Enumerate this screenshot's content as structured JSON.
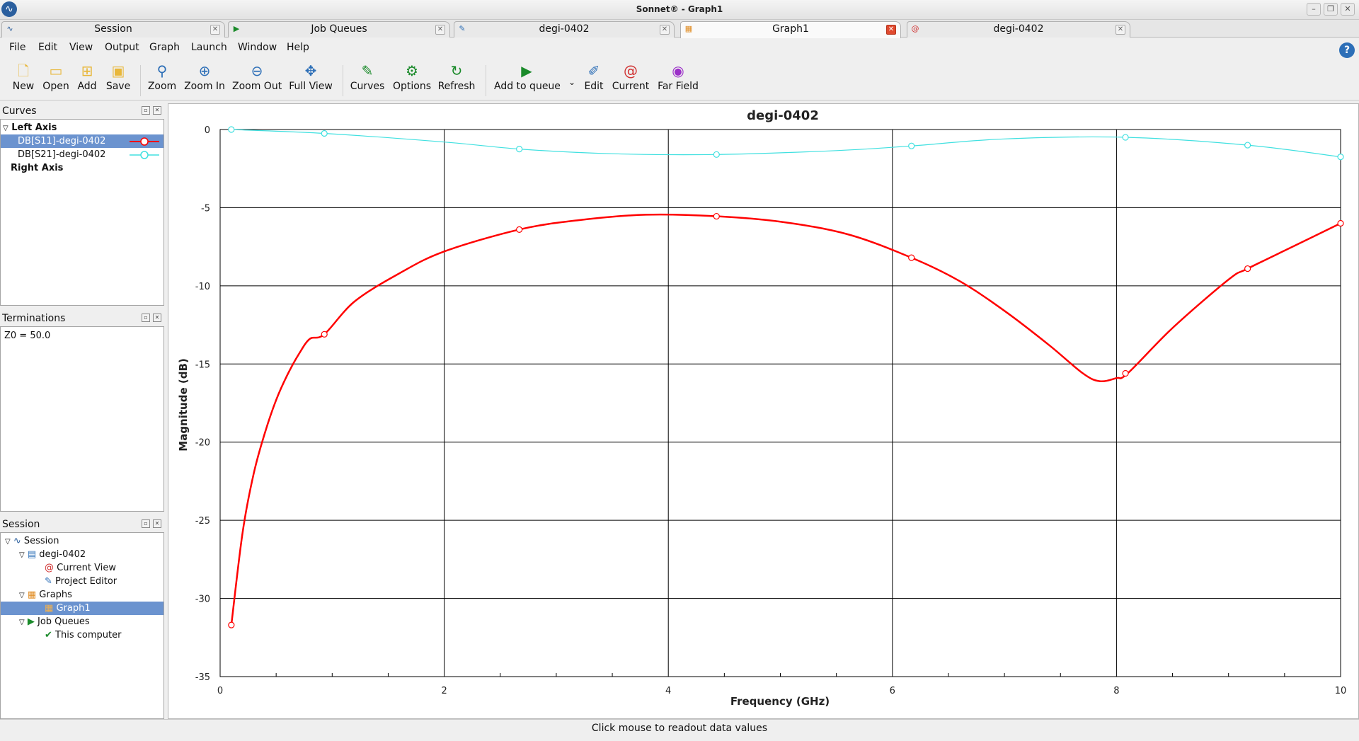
{
  "window": {
    "title": "Sonnet® - Graph1"
  },
  "tabs": [
    {
      "label": "Session",
      "icon": "session-wave-icon"
    },
    {
      "label": "Job Queues",
      "icon": "em-play-icon"
    },
    {
      "label": "degi-0402",
      "icon": "project-editor-icon"
    },
    {
      "label": "Graph1",
      "icon": "graph-icon"
    },
    {
      "label": "degi-0402",
      "icon": "current-spiral-icon"
    }
  ],
  "menu": [
    "File",
    "Edit",
    "View",
    "Output",
    "Graph",
    "Launch",
    "Window",
    "Help"
  ],
  "toolbar": {
    "new": "New",
    "open": "Open",
    "add": "Add",
    "save": "Save",
    "zoom": "Zoom",
    "zoom_in": "Zoom In",
    "zoom_out": "Zoom Out",
    "full_view": "Full View",
    "curves": "Curves",
    "options": "Options",
    "refresh": "Refresh",
    "add_to_queue": "Add to queue",
    "edit": "Edit",
    "current": "Current",
    "far_field": "Far Field"
  },
  "curves_panel": {
    "title": "Curves",
    "left_axis": "Left Axis",
    "items": [
      "DB[S11]-degi-0402",
      "DB[S21]-degi-0402"
    ],
    "right_axis": "Right Axis"
  },
  "terminations_panel": {
    "title": "Terminations",
    "text": "Z0 = 50.0"
  },
  "session_panel": {
    "title": "Session",
    "tree": {
      "root": "Session",
      "project": "degi-0402",
      "current_view": "Current View",
      "project_editor": "Project Editor",
      "graphs": "Graphs",
      "graph1": "Graph1",
      "job_queues": "Job Queues",
      "this_computer": "This computer"
    }
  },
  "status": {
    "text": "Click mouse to readout data values"
  },
  "colors": {
    "s11": "#ff0000",
    "s21": "#40e0e0",
    "selection": "#6b93cf"
  },
  "chart_data": {
    "type": "line",
    "title": "degi-0402",
    "xlabel": "Frequency (GHz)",
    "ylabel": "Magnitude (dB)",
    "xlim": [
      0,
      10
    ],
    "ylim": [
      -35,
      0
    ],
    "xticks": [
      0,
      2,
      4,
      6,
      8,
      10
    ],
    "yticks": [
      0,
      -5,
      -10,
      -15,
      -20,
      -25,
      -30,
      -35
    ],
    "grid": true,
    "series": [
      {
        "name": "DB[S11]-degi-0402",
        "color": "#ff0000",
        "x": [
          0.1,
          0.2,
          0.3,
          0.4,
          0.5,
          0.6,
          0.7,
          0.8,
          0.93,
          1.2,
          1.6,
          2.0,
          2.67,
          3.2,
          3.8,
          4.43,
          5.0,
          5.6,
          6.17,
          6.6,
          7.0,
          7.4,
          7.7,
          7.85,
          8.0,
          8.1,
          8.5,
          9.0,
          9.17,
          9.6,
          10.0
        ],
        "y": [
          -31.7,
          -25.8,
          -22.0,
          -19.4,
          -17.3,
          -15.7,
          -14.4,
          -13.4,
          -13.1,
          -11.0,
          -9.2,
          -7.8,
          -6.4,
          -5.8,
          -5.45,
          -5.55,
          -5.9,
          -6.7,
          -8.2,
          -9.7,
          -11.6,
          -13.8,
          -15.6,
          -16.1,
          -15.9,
          -15.6,
          -12.7,
          -9.6,
          -8.9,
          -7.4,
          -6.0
        ]
      },
      {
        "name": "DB[S21]-degi-0402",
        "color": "#40e0e0",
        "x": [
          0.1,
          0.93,
          2.0,
          2.67,
          3.5,
          4.43,
          5.5,
          6.17,
          7.0,
          8.08,
          9.17,
          10.0
        ],
        "y": [
          0.0,
          -0.25,
          -0.8,
          -1.25,
          -1.55,
          -1.6,
          -1.35,
          -1.05,
          -0.6,
          -0.5,
          -1.0,
          -1.75
        ]
      }
    ],
    "markers": {
      "DB[S11]-degi-0402": [
        [
          0.1,
          -31.7
        ],
        [
          0.93,
          -13.1
        ],
        [
          2.67,
          -6.4
        ],
        [
          4.43,
          -5.55
        ],
        [
          6.17,
          -8.2
        ],
        [
          8.08,
          -15.6
        ],
        [
          9.17,
          -8.9
        ],
        [
          10.0,
          -6.0
        ]
      ],
      "DB[S21]-degi-0402": [
        [
          0.1,
          0.0
        ],
        [
          0.93,
          -0.25
        ],
        [
          2.67,
          -1.25
        ],
        [
          4.43,
          -1.6
        ],
        [
          6.17,
          -1.05
        ],
        [
          8.08,
          -0.5
        ],
        [
          9.17,
          -1.0
        ],
        [
          10.0,
          -1.75
        ]
      ]
    }
  }
}
